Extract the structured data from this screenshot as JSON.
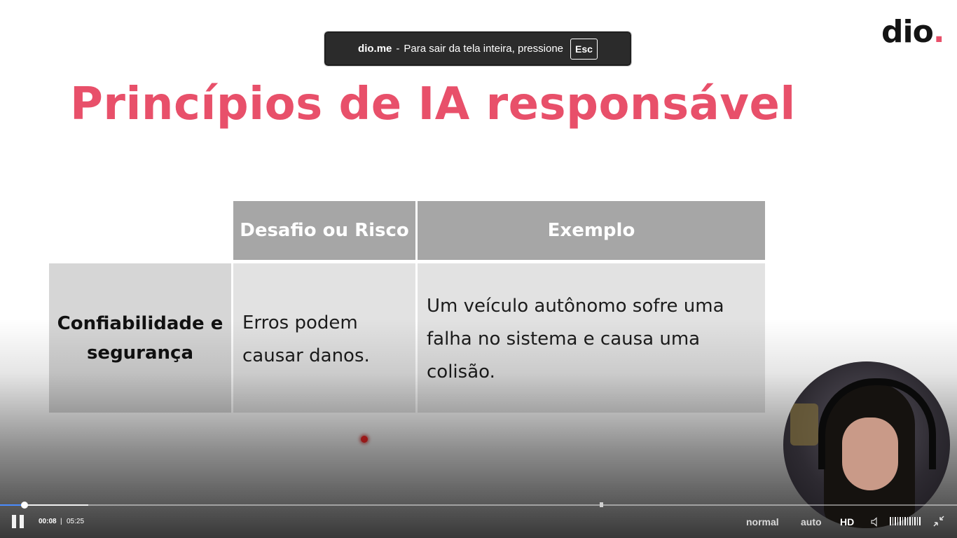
{
  "toast": {
    "site": "dio.me",
    "separator": "-",
    "message": "Para sair da tela inteira, pressione",
    "key": "Esc"
  },
  "logo": {
    "text": "dio",
    "dot": "."
  },
  "slide": {
    "title": "Princípios de IA responsável",
    "table": {
      "headers": [
        "Desafio ou Risco",
        "Exemplo"
      ],
      "rows": [
        {
          "label_line1": "Confiabilidade e",
          "label_line2": "segurança",
          "challenge_line1": "Erros podem",
          "challenge_line2": "causar danos.",
          "example_line1": "Um veículo autônomo sofre uma",
          "example_line2": "falha no sistema e causa uma",
          "example_line3": "colisão."
        }
      ]
    }
  },
  "player": {
    "current_time": "00:08",
    "time_separator": "|",
    "duration": "05:25",
    "speed": "normal",
    "quality": "auto",
    "hd": "HD",
    "progress_fraction": 0.0246
  },
  "colors": {
    "title": "#e8506a",
    "header_bg": "#a6a6a6",
    "progress_played": "#4a8cff"
  },
  "icons": [
    "pause-icon",
    "volume-icon",
    "exit-fullscreen-icon"
  ]
}
